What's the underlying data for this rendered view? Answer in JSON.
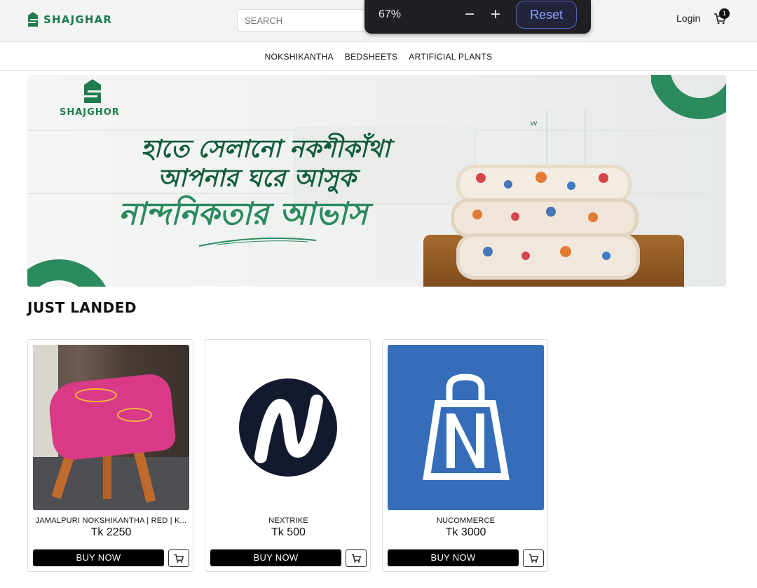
{
  "header": {
    "brand": "SHAJGHAR",
    "search_placeholder": "SEARCH",
    "login": "Login",
    "cart_count": "1"
  },
  "zoom": {
    "level": "67%",
    "minus": "−",
    "plus": "+",
    "reset": "Reset"
  },
  "nav": {
    "items": [
      "NOKSHIKANTHA",
      "BEDSHEETS",
      "ARTIFICIAL PLANTS"
    ]
  },
  "banner": {
    "brand": "SHAJGHOR",
    "line1": "হাতে সেলানো নকশীকাঁথা",
    "line2": "আপনার ঘরে আসুক",
    "line3": "নান্দনিকতার আভাস"
  },
  "section": {
    "title": "JUST LANDED"
  },
  "products": [
    {
      "name": "JAMALPURI NOKSHIKANTHA | RED | K...",
      "price": "Tk 2250",
      "buy": "BUY NOW"
    },
    {
      "name": "NEXTRIKE",
      "price": "Tk 500",
      "buy": "BUY NOW"
    },
    {
      "name": "NUCOMMERCE",
      "price": "Tk 3000",
      "buy": "BUY NOW"
    }
  ],
  "colors": {
    "brand_green": "#1f7a4d",
    "accent_green": "#2b8a5e",
    "nucommerce_blue": "#356db8",
    "nextrike_navy": "#141a2e"
  }
}
